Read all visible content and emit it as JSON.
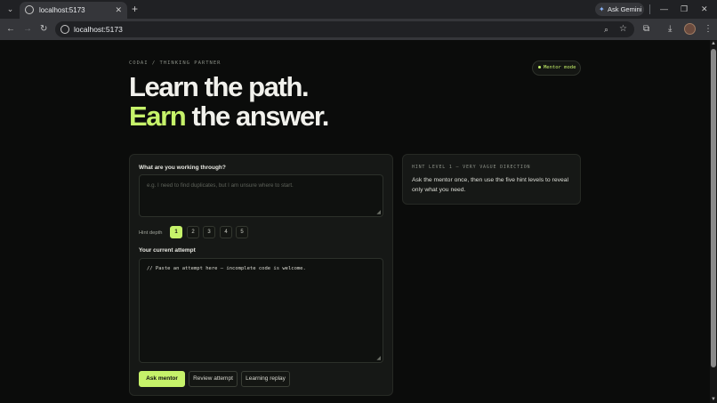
{
  "browser": {
    "tab_title": "localhost:5173",
    "new_tab": "+",
    "tab_close": "✕",
    "gemini_label": "Ask Gemini",
    "url": "localhost:5173",
    "window_controls": {
      "minimize": "—",
      "restore": "❐",
      "close": "✕"
    }
  },
  "page": {
    "eyebrow": "CODAI / THINKING PARTNER",
    "mentor_badge": "Mentor mode",
    "hero_line1": "Learn the path.",
    "hero_line2_accent": "Earn",
    "hero_line2_rest": " the answer.",
    "question_label": "What are you working through?",
    "question_placeholder": "e.g. I need to find duplicates, but I am unsure where to start.",
    "depth_label": "Hint depth",
    "depth_levels": [
      "1",
      "2",
      "3",
      "4",
      "5"
    ],
    "depth_selected": "1",
    "attempt_label": "Your current attempt",
    "attempt_value": "// Paste an attempt here — incomplete code is welcome.",
    "buttons": {
      "ask": "Ask mentor",
      "review": "Review attempt",
      "replay": "Learning replay"
    },
    "hint": {
      "title": "HINT LEVEL 1 — VERY VAGUE DIRECTION",
      "text": "Ask the mentor once, then use the five hint levels to reveal only what you need."
    }
  },
  "colors": {
    "accent": "#c6f26a",
    "background": "#0b0c0b",
    "panel": "#161816"
  }
}
